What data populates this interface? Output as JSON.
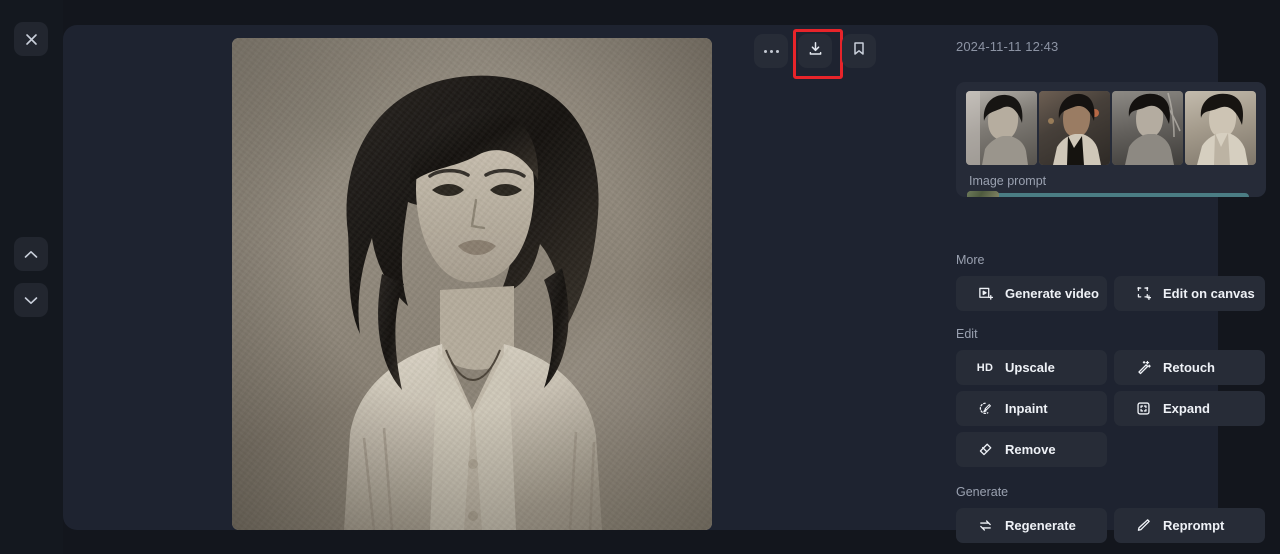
{
  "window": {
    "background_color": "#13161d",
    "panel_color": "#1e2330"
  },
  "rail": {
    "close": {
      "label": "Close",
      "icon": "close-icon"
    },
    "prev": {
      "label": "Previous",
      "icon": "chevron-up-icon"
    },
    "next": {
      "label": "Next",
      "icon": "chevron-down-icon"
    }
  },
  "toolbar": {
    "more_label": "More options",
    "more_icon": "ellipsis-icon",
    "download_label": "Download",
    "download_icon": "download-icon",
    "bookmark_label": "Bookmark",
    "bookmark_icon": "bookmark-icon",
    "highlight_color": "#e8242a",
    "highlighted_item": "download"
  },
  "viewer": {
    "image_alt": "Monochrome illustrated portrait of a woman with shoulder-length wavy hair wearing an open cardigan"
  },
  "details": {
    "timestamp": "2024-11-11 12:43",
    "image_prompt": {
      "label": "Image prompt",
      "thumbnail_count": 4,
      "bar_color": "#4b7d84"
    }
  },
  "sections": [
    {
      "title": "More",
      "buttons": [
        {
          "label": "Generate video",
          "icon": "video-box-icon"
        },
        {
          "label": "Edit on canvas",
          "icon": "canvas-transform-icon"
        }
      ]
    },
    {
      "title": "Edit",
      "buttons": [
        {
          "label": "Upscale",
          "icon": "hd-icon"
        },
        {
          "label": "Retouch",
          "icon": "magic-wand-icon"
        },
        {
          "label": "Inpaint",
          "icon": "inpaint-brush-icon"
        },
        {
          "label": "Expand",
          "icon": "expand-frame-icon"
        },
        {
          "label": "Remove",
          "icon": "eraser-icon"
        }
      ]
    },
    {
      "title": "Generate",
      "buttons": [
        {
          "label": "Regenerate",
          "icon": "refresh-icon"
        },
        {
          "label": "Reprompt",
          "icon": "pencil-icon"
        }
      ]
    }
  ]
}
